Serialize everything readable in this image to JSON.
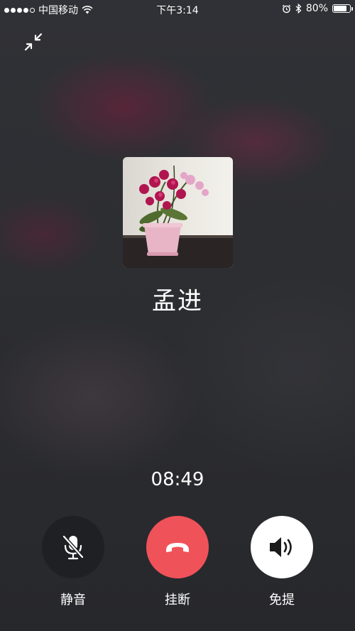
{
  "status_bar": {
    "carrier": "中国移动",
    "time": "下午3:14",
    "battery": "80%",
    "battery_level": 0.8,
    "icons": [
      "signal-dots",
      "wifi-icon",
      "alarm-icon",
      "bluetooth-icon",
      "battery-icon"
    ]
  },
  "call": {
    "caller_name": "孟进",
    "duration": "08:49"
  },
  "controls": {
    "mute_label": "静音",
    "hangup_label": "挂断",
    "speaker_label": "免提"
  },
  "colors": {
    "hangup": "#f0525a",
    "mute_bg": "#1f2023",
    "speaker_bg": "#ffffff",
    "background": "#2b2c30"
  },
  "icons": {
    "minimize": "minimize-arrows-icon",
    "mute": "microphone-off-icon",
    "hangup": "phone-hangup-icon",
    "speaker": "speaker-icon"
  }
}
